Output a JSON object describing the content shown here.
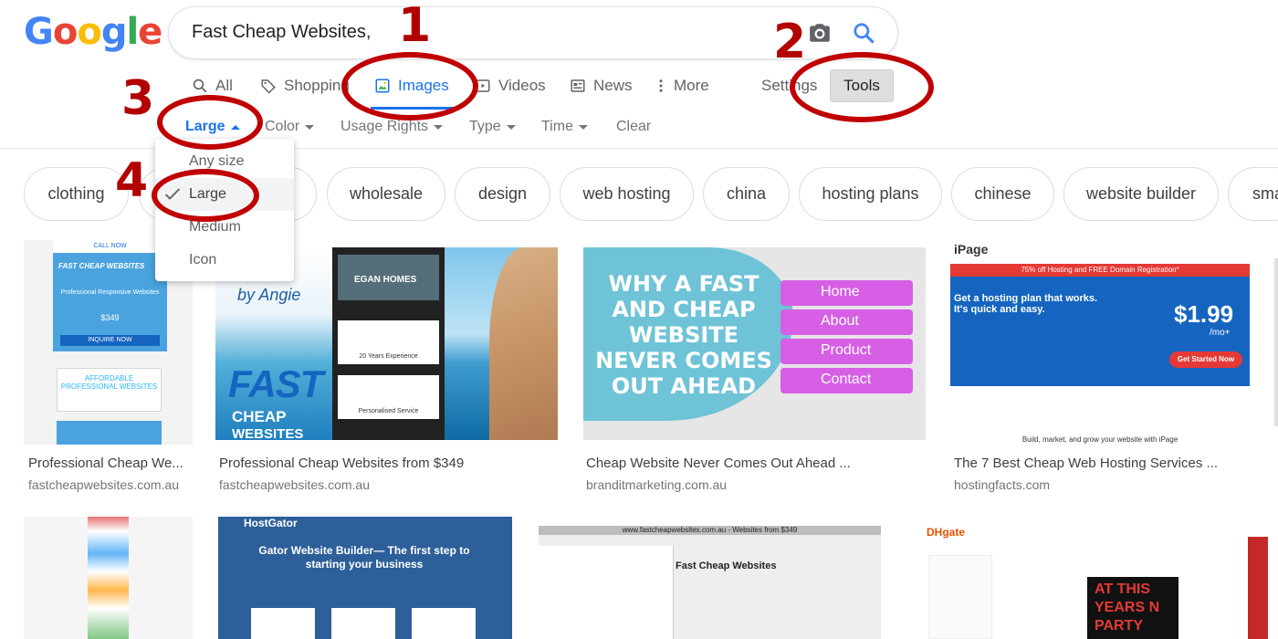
{
  "logo": {
    "letters": [
      "G",
      "o",
      "o",
      "g",
      "l",
      "e"
    ],
    "colors": [
      "#4285f4",
      "#ea4335",
      "#fbbc05",
      "#4285f4",
      "#34a853",
      "#ea4335"
    ]
  },
  "search": {
    "query": "Fast Cheap Websites,",
    "camera_icon": "camera-icon",
    "search_icon": "magnifier-icon"
  },
  "tabs": {
    "all": "All",
    "shopping": "Shopping",
    "images": "Images",
    "videos": "Videos",
    "news": "News",
    "more": "More",
    "settings": "Settings",
    "tools": "Tools"
  },
  "filters": {
    "size": "Large",
    "color": "Color",
    "usage": "Usage Rights",
    "type": "Type",
    "time": "Time",
    "clear": "Clear"
  },
  "size_menu": {
    "options": [
      "Any size",
      "Large",
      "Medium",
      "Icon"
    ],
    "selected": "Large"
  },
  "chips": [
    "clothing",
    "wholesale",
    "design",
    "web hosting",
    "china",
    "hosting plans",
    "chinese",
    "website builder",
    "sma"
  ],
  "results": [
    {
      "title": "Professional Cheap We...",
      "site": "fastcheapwebsites.com.au"
    },
    {
      "title": "Professional Cheap Websites from $349",
      "site": "fastcheapwebsites.com.au"
    },
    {
      "title": "Cheap Website Never Comes Out Ahead ...",
      "site": "branditmarketing.com.au"
    },
    {
      "title": "The 7 Best Cheap Web Hosting Services ...",
      "site": "hostingfacts.com"
    }
  ],
  "thumb_text": {
    "t1": {
      "call": "CALL NOW",
      "brand": "FAST CHEAP WEBSITES",
      "sub": "Professional Responsive Websites",
      "price": "$349",
      "cta": "INQUIRE NOW",
      "badge": "AFFORDABLE PROFESSIONAL WEBSITES"
    },
    "t2": {
      "fast": "FAST",
      "cheap": "CHEAP",
      "websites": "WEBSITES",
      "by": "by Angie",
      "egan": "EGAN HOMES",
      "exp": "20 Years Experience",
      "svc": "Personalised Service"
    },
    "t3": {
      "headline": "WHY A FAST AND CHEAP WEBSITE NEVER COMES OUT AHEAD",
      "home": "Home",
      "about": "About",
      "product": "Product",
      "contact": "Contact"
    },
    "t4": {
      "brand": "iPage",
      "banner": "75% off Hosting and FREE Domain Registration*",
      "headline": "Get a hosting plan that works. It's quick and easy.",
      "price": "$1.99",
      "per": "/mo+",
      "cta": "Get Started Now",
      "footer": "Build, market, and grow your website with iPage"
    },
    "t6": {
      "brand": "HostGator",
      "headline": "Gator Website Builder— The first step to starting your business"
    },
    "t7": {
      "url": "www.fastcheapwebsites.com.au - Websites from $349",
      "brand": "Fast Cheap Websites"
    },
    "t8": {
      "brand": "DHgate",
      "promo": "AT THIS YEARS N PARTY"
    }
  },
  "annotations": [
    "1",
    "2",
    "3",
    "4"
  ],
  "colors": {
    "accent": "#1a73e8",
    "annotation": "#c00000"
  }
}
